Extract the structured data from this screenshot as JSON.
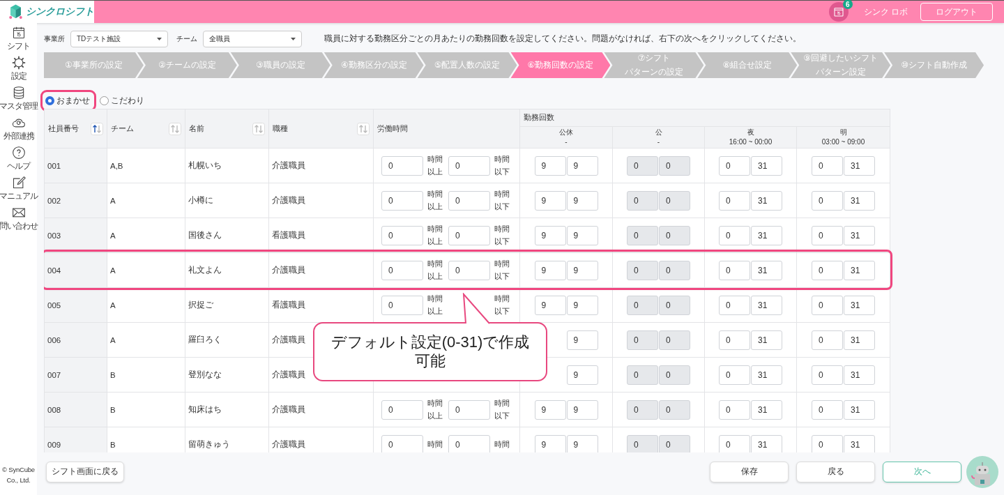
{
  "header": {
    "logo": "シンクロシフト",
    "notification_count": "6",
    "user": "シンク ロボ",
    "logout": "ログアウト"
  },
  "sidebar": {
    "items": [
      {
        "label": "シフト"
      },
      {
        "label": "設定"
      },
      {
        "label": "マスタ管理"
      },
      {
        "label": "外部連携"
      },
      {
        "label": "ヘルプ"
      },
      {
        "label": "マニュアル"
      },
      {
        "label": "問い合わせ"
      }
    ],
    "copyright": "© SynCube Co., Ltd."
  },
  "filters": [
    {
      "label": "事業所",
      "value": "TDテスト施設"
    },
    {
      "label": "チーム",
      "value": "全職員"
    }
  ],
  "instruction": "職員に対する勤務区分ごとの月あたりの勤務回数を設定してください。問題がなければ、右下の次へをクリックしてください。",
  "steps": [
    {
      "lines": [
        "①事業所の設定"
      ],
      "selected": false
    },
    {
      "lines": [
        "②チームの設定"
      ],
      "selected": false
    },
    {
      "lines": [
        "③職員の設定"
      ],
      "selected": false
    },
    {
      "lines": [
        "④勤務区分の設定"
      ],
      "selected": false
    },
    {
      "lines": [
        "⑤配置人数の設定"
      ],
      "selected": false
    },
    {
      "lines": [
        "⑥勤務回数の設定"
      ],
      "selected": true
    },
    {
      "lines": [
        "⑦シフト",
        "パターンの設定"
      ],
      "selected": false
    },
    {
      "lines": [
        "⑧組合せ設定"
      ],
      "selected": false
    },
    {
      "lines": [
        "⑨回避したいシフト",
        "パターン設定"
      ],
      "selected": false
    },
    {
      "lines": [
        "⑩シフト自動作成"
      ],
      "selected": false
    }
  ],
  "mode_options": [
    {
      "label": "おまかせ",
      "selected": true,
      "highlighted": true
    },
    {
      "label": "こだわり",
      "selected": false,
      "highlighted": false
    }
  ],
  "table": {
    "columns": [
      {
        "label": "社員番号",
        "sort_active": true
      },
      {
        "label": "チーム",
        "sort_active": false
      },
      {
        "label": "名前",
        "sort_active": false
      },
      {
        "label": "職種",
        "sort_active": false
      }
    ],
    "hours_header": "労働時間",
    "counts_header": "勤務回数",
    "shift_columns": [
      {
        "name": "公休",
        "time": "-",
        "disabled": false
      },
      {
        "name": "公",
        "time": "-",
        "disabled": true
      },
      {
        "name": "夜",
        "time": "16:00 ~ 00:00",
        "disabled": false
      },
      {
        "name": "明",
        "time": "03:00 ~ 09:00",
        "disabled": false
      }
    ],
    "rows": [
      {
        "id": "001",
        "team": "A,B",
        "name": "札幌いち",
        "job": "介護職員",
        "highlighted": false,
        "hours_min": {
          "value": "0",
          "unit": "時間以上"
        },
        "hours_max": {
          "value": "0",
          "unit": "時間以下"
        },
        "counts": [
          {
            "min": "9",
            "max": "9"
          },
          {
            "min": "0",
            "max": "0"
          },
          {
            "min": "0",
            "max": "31"
          },
          {
            "min": "0",
            "max": "31"
          }
        ]
      },
      {
        "id": "002",
        "team": "A",
        "name": "小樽に",
        "job": "介護職員",
        "highlighted": false,
        "hours_min": {
          "value": "0",
          "unit": "時間以上"
        },
        "hours_max": {
          "value": "0",
          "unit": "時間以下"
        },
        "counts": [
          {
            "min": "9",
            "max": "9"
          },
          {
            "min": "0",
            "max": "0"
          },
          {
            "min": "0",
            "max": "31"
          },
          {
            "min": "0",
            "max": "31"
          }
        ]
      },
      {
        "id": "003",
        "team": "A",
        "name": "国後さん",
        "job": "看護職員",
        "highlighted": false,
        "hours_min": {
          "value": "0",
          "unit": "時間以上"
        },
        "hours_max": {
          "value": "0",
          "unit": "時間以下"
        },
        "counts": [
          {
            "min": "9",
            "max": "9"
          },
          {
            "min": "0",
            "max": "0"
          },
          {
            "min": "0",
            "max": "31"
          },
          {
            "min": "0",
            "max": "31"
          }
        ]
      },
      {
        "id": "004",
        "team": "A",
        "name": "礼文よん",
        "job": "介護職員",
        "highlighted": true,
        "hours_min": {
          "value": "0",
          "unit": "時間以上"
        },
        "hours_max": {
          "value": "0",
          "unit": "時間以下"
        },
        "counts": [
          {
            "min": "9",
            "max": "9"
          },
          {
            "min": "0",
            "max": "0"
          },
          {
            "min": "0",
            "max": "31"
          },
          {
            "min": "0",
            "max": "31"
          }
        ]
      },
      {
        "id": "005",
        "team": "A",
        "name": "択捉ご",
        "job": "看護職員",
        "highlighted": false,
        "hours_min": {
          "value": "0",
          "unit": "時間以上"
        },
        "hours_max": {
          "unit": "時間以下"
        },
        "counts": [
          {
            "min": "9",
            "max": "9"
          },
          {
            "min": "0",
            "max": "0"
          },
          {
            "min": "0",
            "max": "31"
          },
          {
            "min": "0",
            "max": "31"
          }
        ]
      },
      {
        "id": "006",
        "team": "A",
        "name": "羅臼ろく",
        "job": "介護職員",
        "highlighted": false,
        "counts": [
          {
            "max": "9"
          },
          {
            "min": "0",
            "max": "0"
          },
          {
            "min": "0",
            "max": "31"
          },
          {
            "min": "0",
            "max": "31"
          }
        ]
      },
      {
        "id": "007",
        "team": "B",
        "name": "登別なな",
        "job": "介護職員",
        "highlighted": false,
        "counts": [
          {
            "max": "9"
          },
          {
            "min": "0",
            "max": "0"
          },
          {
            "min": "0",
            "max": "31"
          },
          {
            "min": "0",
            "max": "31"
          }
        ]
      },
      {
        "id": "008",
        "team": "B",
        "name": "知床はち",
        "job": "介護職員",
        "highlighted": false,
        "hours_min": {
          "value": "0",
          "unit": "時間以上"
        },
        "hours_max": {
          "value": "0",
          "unit": "時間以下"
        },
        "counts": [
          {
            "min": "9",
            "max": "9"
          },
          {
            "min": "0",
            "max": "0"
          },
          {
            "min": "0",
            "max": "31"
          },
          {
            "min": "0",
            "max": "31"
          }
        ]
      },
      {
        "id": "009",
        "team": "B",
        "name": "留萌きゅう",
        "job": "介護職員",
        "highlighted": false,
        "hours_min": {
          "value": "0",
          "unit": "時間"
        },
        "hours_max": {
          "value": "0",
          "unit": "時間"
        },
        "counts": [
          {
            "min": "9",
            "max": "9"
          },
          {
            "min": "0",
            "max": "0"
          },
          {
            "min": "0",
            "max": "31"
          },
          {
            "min": "0",
            "max": "31"
          }
        ]
      }
    ]
  },
  "callout": "デフォルト設定(0-31)で作成可能",
  "footer": {
    "back_to_shift": "シフト画面に戻る",
    "buttons": [
      {
        "label": "保存",
        "kind": "plain"
      },
      {
        "label": "戻る",
        "kind": "plain"
      },
      {
        "label": "次へ",
        "kind": "primary"
      }
    ]
  }
}
